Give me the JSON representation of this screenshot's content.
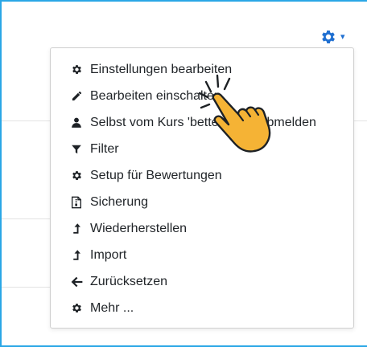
{
  "header": {
    "settings_icon": "gear-icon",
    "settings_caret": "▾"
  },
  "menu": {
    "items": [
      {
        "label": "Einstellungen bearbeiten",
        "icon": "gear-icon"
      },
      {
        "label": "Bearbeiten einschalten",
        "icon": "pencil-icon"
      },
      {
        "label": "Selbst vom Kurs 'better tests' abmelden",
        "icon": "user-icon"
      },
      {
        "label": "Filter",
        "icon": "filter-icon"
      },
      {
        "label": "Setup für Bewertungen",
        "icon": "gear-icon"
      },
      {
        "label": "Sicherung",
        "icon": "archive-file-icon"
      },
      {
        "label": "Wiederherstellen",
        "icon": "level-up-icon"
      },
      {
        "label": "Import",
        "icon": "level-up-icon"
      },
      {
        "label": "Zurücksetzen",
        "icon": "arrow-left-icon"
      },
      {
        "label": "Mehr ...",
        "icon": "gear-icon"
      }
    ]
  },
  "overlay": {
    "icon": "pointing-hand-icon"
  },
  "colors": {
    "frame_border": "#2aa7e6",
    "accent": "#1f6fd1",
    "hand_fill": "#f5b335"
  }
}
